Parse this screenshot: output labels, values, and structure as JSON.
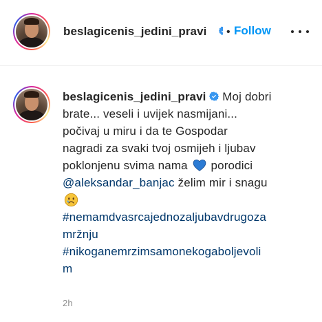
{
  "post": {
    "username": "beslagicenis_jedini_pravi",
    "verified": true,
    "follow_label": "Follow",
    "separator": "•",
    "more_icon": "more-horizontal-icon"
  },
  "caption": {
    "username": "beslagicenis_jedini_pravi",
    "line1": "Moj dobri",
    "line2": "brate... veseli i uvijek nasmijani...",
    "line3": "počivaj u miru i da te Gospodar",
    "line4": "nagradi za svaki tvoj osmijeh i ljubav",
    "line5_before": "poklonjenu svima nama",
    "line5_after": "porodici",
    "mention": "@aleksandar_banjac",
    "line6_after": "želim mir i snagu",
    "hashtag1_part1": "#nemamdvasrcajednozaljubavdrugoza",
    "hashtag1_part2": "mržnju",
    "hashtag2_part1": "#nikoganemrzimsamonekogaboljevoli",
    "hashtag2_part2": "m",
    "emojis": [
      "blue-heart-icon",
      "sad-face-icon"
    ],
    "timestamp": "2h"
  },
  "colors": {
    "link_blue": "#0095f6",
    "hashtag_blue": "#00376b",
    "text": "#262626",
    "muted": "#8e8e8e",
    "verified_blue": "#3897f0",
    "heart_blue": "#2b7bd4"
  }
}
